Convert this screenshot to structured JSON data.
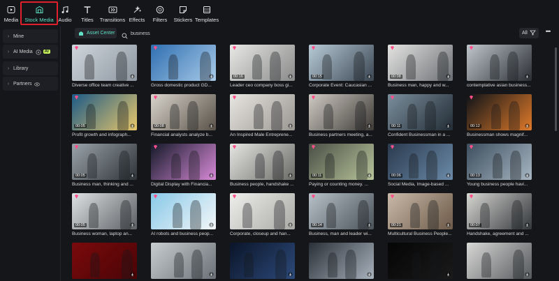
{
  "toolbar": {
    "items": [
      {
        "label": "Media",
        "icon": "media-icon"
      },
      {
        "label": "Stock Media",
        "icon": "stock-media-icon",
        "active": true
      },
      {
        "label": "Audio",
        "icon": "audio-icon"
      },
      {
        "label": "Titles",
        "icon": "titles-icon"
      },
      {
        "label": "Transitions",
        "icon": "transitions-icon"
      },
      {
        "label": "Effects",
        "icon": "effects-icon"
      },
      {
        "label": "Filters",
        "icon": "filters-icon"
      },
      {
        "label": "Stickers",
        "icon": "stickers-icon"
      },
      {
        "label": "Templates",
        "icon": "templates-icon"
      }
    ],
    "active_color": "#5fe0c4",
    "highlight_color": "#e0202a"
  },
  "sidebar": {
    "items": [
      {
        "label": "Mine"
      },
      {
        "label": "AI Media",
        "badge": "AI"
      },
      {
        "label": "Library"
      },
      {
        "label": "Partners"
      }
    ]
  },
  "search": {
    "asset_center_label": "Asset Center",
    "value": "business",
    "filter_label": "All",
    "more_label": "•••"
  },
  "cards": [
    {
      "caption": "Diverse office team creative ...",
      "duration": "",
      "colors": [
        "#cfd6dc",
        "#8d96a0"
      ]
    },
    {
      "caption": "Gross domestic product GD...",
      "duration": "",
      "colors": [
        "#2f6fb1",
        "#a9cbe8"
      ]
    },
    {
      "caption": "Leader ceo company boss gi...",
      "duration": "00:16",
      "colors": [
        "#e8e8e6",
        "#8a8a8a"
      ]
    },
    {
      "caption": "Corporate Event: Caucasian ...",
      "duration": "00:15",
      "colors": [
        "#b9cbd8",
        "#3a4652"
      ]
    },
    {
      "caption": "Business man, happy and w...",
      "duration": "00:08",
      "colors": [
        "#e4e4e2",
        "#6c6f74"
      ]
    },
    {
      "caption": "contemplative asian business...",
      "duration": "",
      "colors": [
        "#bfc6cc",
        "#2b2e33"
      ]
    },
    {
      "caption": "Profit growth and infograph...",
      "duration": "00:05",
      "colors": [
        "#1d5a86",
        "#e8c76a"
      ]
    },
    {
      "caption": "Financial analysts analyze b...",
      "duration": "00:08",
      "colors": [
        "#d8d4cc",
        "#5a5248"
      ]
    },
    {
      "caption": "An Inspired Male Entreprene...",
      "duration": "",
      "colors": [
        "#e8e6e2",
        "#9a9692"
      ]
    },
    {
      "caption": "Business partners meeting, a...",
      "duration": "",
      "colors": [
        "#cfcac3",
        "#3d3a36"
      ]
    },
    {
      "caption": "Confident Businessman in a ...",
      "duration": "00:11",
      "colors": [
        "#7b8e9c",
        "#222c35"
      ]
    },
    {
      "caption": "Businessman shows magnif...",
      "duration": "00:12",
      "colors": [
        "#0f1318",
        "#e07a2a"
      ]
    },
    {
      "caption": "Business man, thinking and ...",
      "duration": "00:05",
      "colors": [
        "#9aa3aa",
        "#2e3338"
      ]
    },
    {
      "caption": "Digital Display with Financia...",
      "duration": "",
      "colors": [
        "#151a2a",
        "#d88ad8"
      ]
    },
    {
      "caption": "Business people, handshake ...",
      "duration": "",
      "colors": [
        "#e5e5e3",
        "#6a6a66"
      ]
    },
    {
      "caption": "Paying or counting money. ...",
      "duration": "00:11",
      "colors": [
        "#4a4f46",
        "#b9c59b"
      ]
    },
    {
      "caption": "Social Media, Image-based ...",
      "duration": "00:06",
      "colors": [
        "#2a3a4e",
        "#6b8aa8"
      ]
    },
    {
      "caption": "Young business people havi...",
      "duration": "00:13",
      "colors": [
        "#3d4e5e",
        "#a7b6c2"
      ]
    },
    {
      "caption": "Business woman, laptop an...",
      "duration": "00:05",
      "colors": [
        "#dfe2e4",
        "#5c5f63"
      ]
    },
    {
      "caption": "AI robots and business peop...",
      "duration": "",
      "colors": [
        "#89c9e8",
        "#f2f6f8"
      ]
    },
    {
      "caption": "Corporate, closeup and han...",
      "duration": "",
      "colors": [
        "#eeeeec",
        "#a9a9a5"
      ]
    },
    {
      "caption": "Business, man and leader wi...",
      "duration": "00:14",
      "colors": [
        "#b7c1c8",
        "#4a525a"
      ]
    },
    {
      "caption": "Multicultural Business People...",
      "duration": "00:21",
      "colors": [
        "#c9b9a8",
        "#6d5a49"
      ]
    },
    {
      "caption": "Handshake, agreement and ...",
      "duration": "00:07",
      "colors": [
        "#d6d6d2",
        "#34373b"
      ]
    },
    {
      "caption": "",
      "duration": "",
      "colors": [
        "#7a0a0c",
        "#4a0406"
      ]
    },
    {
      "caption": "",
      "duration": "",
      "colors": [
        "#c9cdd0",
        "#6a7076"
      ]
    },
    {
      "caption": "",
      "duration": "",
      "colors": [
        "#0a1428",
        "#2d4a7a"
      ]
    },
    {
      "caption": "",
      "duration": "",
      "colors": [
        "#2a3038",
        "#a8b2bc"
      ]
    },
    {
      "caption": "",
      "duration": "",
      "colors": [
        "#050505",
        "#1a1a1a"
      ]
    },
    {
      "caption": "",
      "duration": "",
      "colors": [
        "#d8d8d6",
        "#55585c"
      ]
    }
  ]
}
